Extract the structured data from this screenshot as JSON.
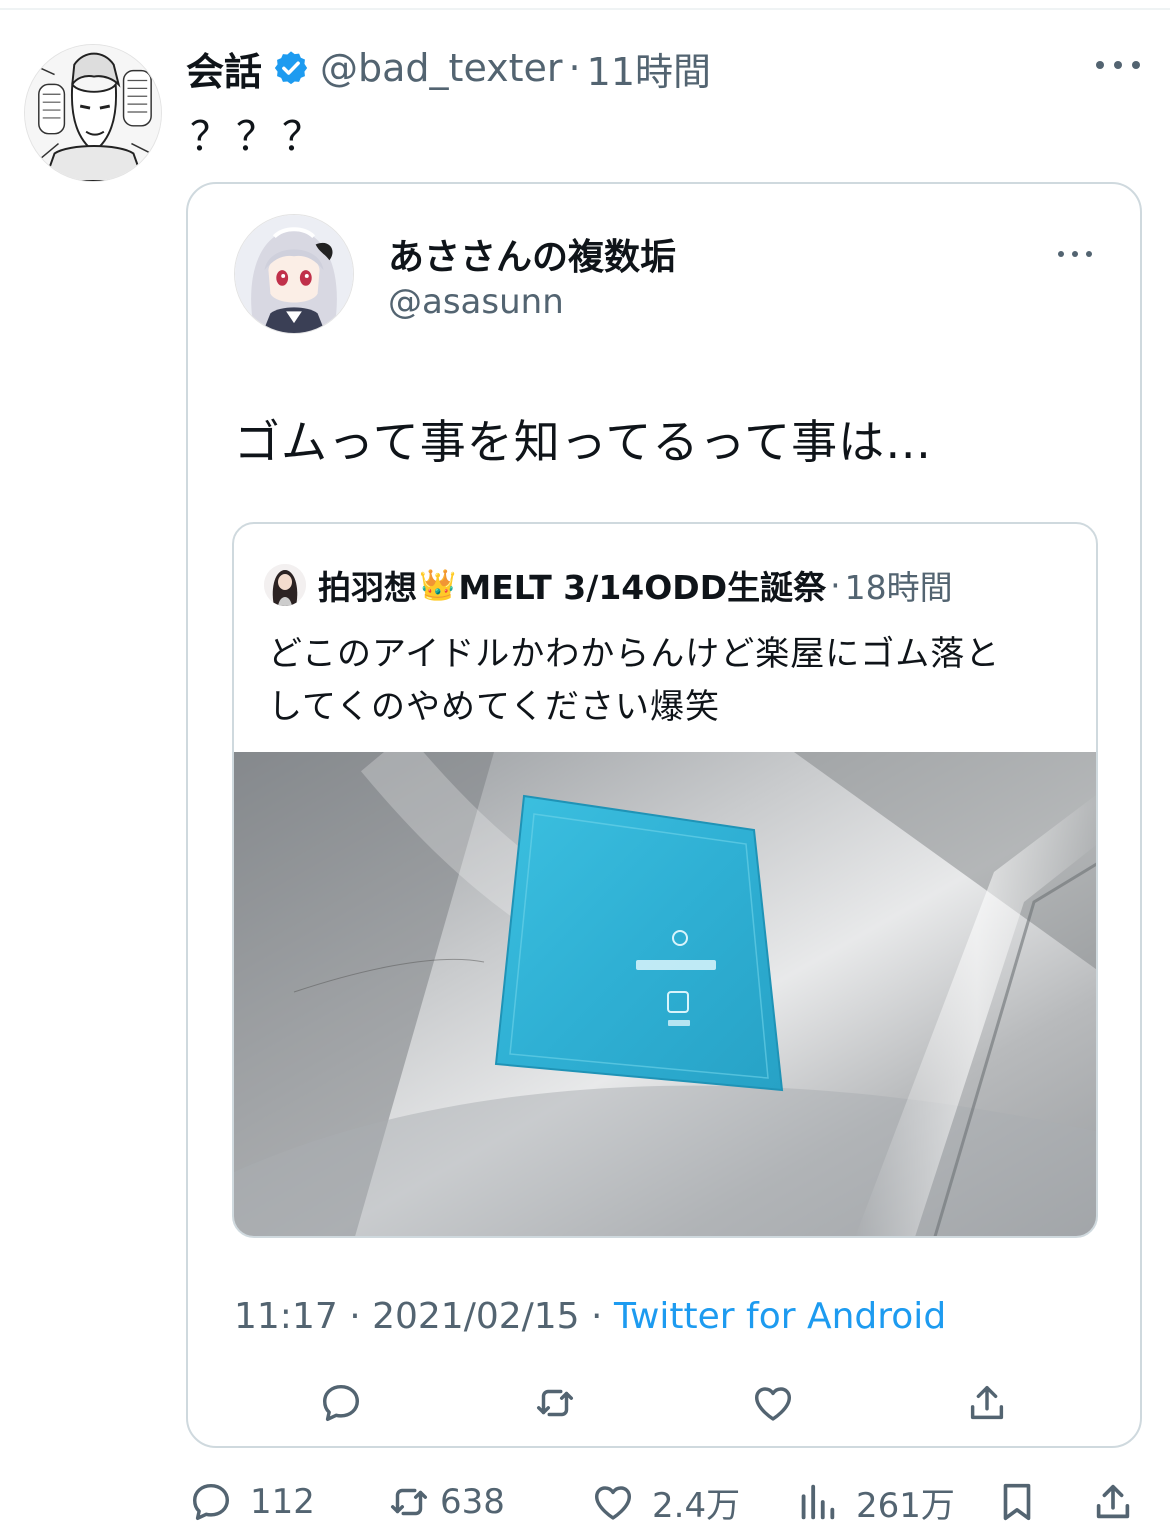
{
  "colors": {
    "text": "#0f1419",
    "secondary": "#536471",
    "link": "#1d9bf0",
    "border": "#cfd9de",
    "verified": "#1d9bf0",
    "packet": "#35b6d8"
  },
  "tweet": {
    "author_name": "会話",
    "verified_icon": "verified-badge-icon",
    "handle": "@bad_texter",
    "separator": "·",
    "time": "11時間",
    "text": "？？？"
  },
  "quote": {
    "author_name": "あささんの複数垢",
    "handle": "@asasunn",
    "text": "ゴムって事を知ってるって事は…",
    "inner": {
      "author_name_a": "拍羽想",
      "crown": "👑",
      "author_name_b": "MELT 3/14ODD生誕祭",
      "separator": "·",
      "time": "18時間",
      "text_lines": [
        "どこのアイドルかわからんけど楽屋にゴム落と",
        "してくのやめてください爆笑"
      ]
    },
    "meta": {
      "time": "11:17",
      "sep1": " · ",
      "date": "2021/02/15",
      "sep2": " · ",
      "client": "Twitter for Android"
    }
  },
  "actions": {
    "replies": "112",
    "retweets": "638",
    "likes": "2.4万",
    "views": "261万"
  }
}
